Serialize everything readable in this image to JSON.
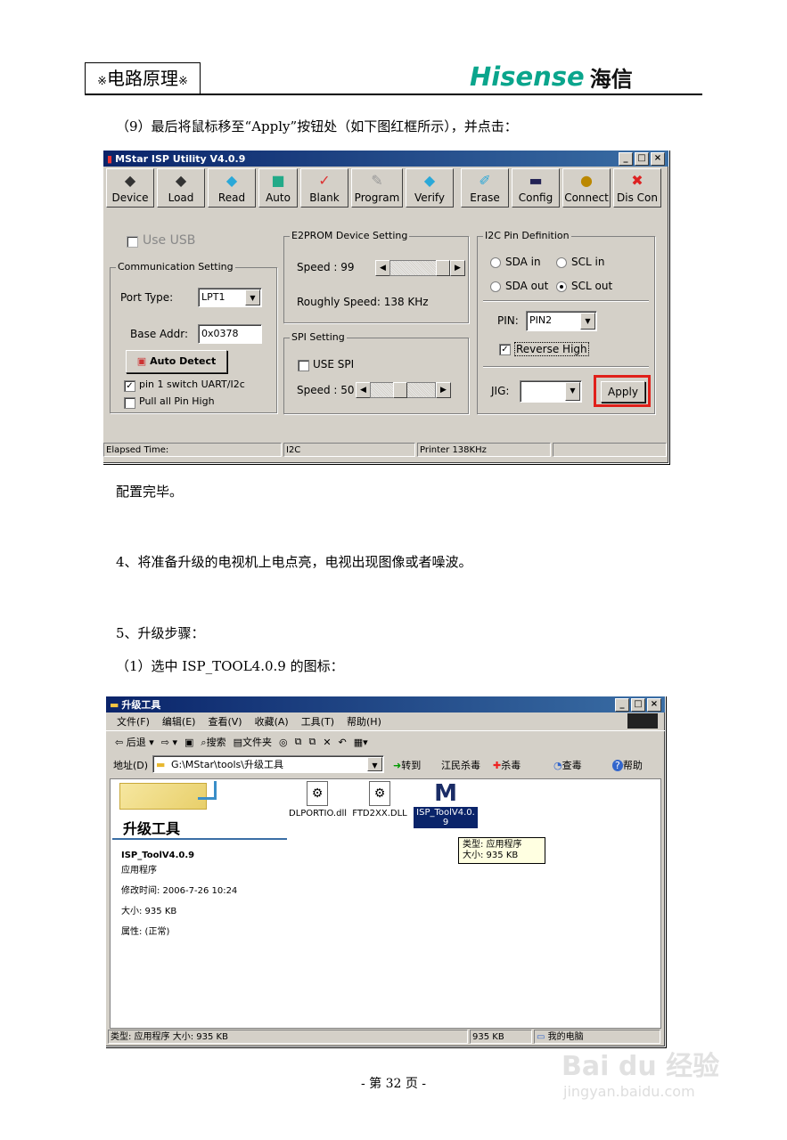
{
  "header": {
    "marker": "※",
    "title": "电路原理",
    "brand_en": "Hisense",
    "brand_cn": "海信"
  },
  "paragraphs": {
    "step9": "（9）最后将鼠标移至“Apply”按钮处（如下图红框所示），并点击：",
    "config_done": "配置完毕。",
    "step4": "4、将准备升级的电视机上电点亮，电视出现图像或者噪波。",
    "step5": "5、升级步骤：",
    "step1": "（1）选中 ISP_TOOL4.0.9 的图标："
  },
  "isp_window": {
    "title": "MStar ISP Utility V4.0.9",
    "toolbar": [
      {
        "label": "Device",
        "icon": "chip-icon"
      },
      {
        "label": "Load",
        "icon": "load-icon"
      },
      {
        "label": "Read",
        "icon": "read-icon"
      },
      {
        "label": "Auto",
        "icon": "auto-icon"
      },
      {
        "label": "Blank",
        "icon": "blank-icon"
      },
      {
        "label": "Program",
        "icon": "program-icon"
      },
      {
        "label": "Verify",
        "icon": "verify-icon"
      },
      {
        "label": "Erase",
        "icon": "erase-icon"
      },
      {
        "label": "Config",
        "icon": "config-icon"
      },
      {
        "label": "Connect",
        "icon": "connect-icon"
      },
      {
        "label": "Dis Con",
        "icon": "disconnect-icon"
      }
    ],
    "use_usb": "Use USB",
    "comm_group": "Communication Setting",
    "port_type_label": "Port Type:",
    "port_type_value": "LPT1",
    "base_addr_label": "Base Addr:",
    "base_addr_value": "0x0378",
    "auto_detect": "Auto Detect",
    "pin1_switch": "pin 1 switch UART/I2c",
    "pull_all": "Pull all Pin High",
    "e2prom_group": "E2PROM Device Setting",
    "speed_label": "Speed : 99",
    "roughly_speed": "Roughly Speed: 138 KHz",
    "spi_group": "SPI Setting",
    "use_spi": "USE SPI",
    "spi_speed_label": "Speed : 50",
    "i2c_group": "I2C Pin Definition",
    "sda_in": "SDA in",
    "scl_in": "SCL in",
    "sda_out": "SDA out",
    "scl_out": "SCL out",
    "pin_label": "PIN:",
    "pin_value": "PIN2",
    "reverse_high": "Reverse High",
    "jig_label": "JIG:",
    "apply": "Apply",
    "status": {
      "elapsed": "Elapsed Time:",
      "bus": "I2C",
      "printer": "Printer  138KHz"
    },
    "highlight_color": "#e0201a"
  },
  "explorer": {
    "title": "升级工具",
    "menu": [
      "文件(F)",
      "编辑(E)",
      "查看(V)",
      "收藏(A)",
      "工具(T)",
      "帮助(H)"
    ],
    "toolbar": {
      "back": "后退",
      "search": "搜索",
      "folders": "文件夹"
    },
    "address_label": "地址(D)",
    "address_value": "G:\\MStar\\tools\\升级工具",
    "go": "转到",
    "jiangmin": "江民杀毒",
    "kill": "杀毒",
    "scan": "查毒",
    "help": "帮助",
    "panel_title": "升级工具",
    "selected_name": "ISP_ToolV4.0.9",
    "selected_type": "应用程序",
    "modified": "修改时间: 2006-7-26 10:24",
    "size": "大小: 935 KB",
    "attributes": "属性: (正常)",
    "files": [
      {
        "name": "DLPORTIO.dll",
        "icon": "dll-icon"
      },
      {
        "name": "FTD2XX.DLL",
        "icon": "dll-icon"
      },
      {
        "name": "ISP_ToolV4.0.9",
        "icon": "mstar-app-icon"
      }
    ],
    "tooltip": {
      "type": "类型: 应用程序",
      "size": "大小: 935 KB"
    },
    "status": {
      "left": "类型: 应用程序 大小: 935 KB",
      "mid": "935 KB",
      "right": "我的电脑"
    }
  },
  "footer": {
    "page": "- 第 32 页 -"
  },
  "watermark": {
    "brand": "Bai du 经验",
    "url": "jingyan.baidu.com"
  }
}
